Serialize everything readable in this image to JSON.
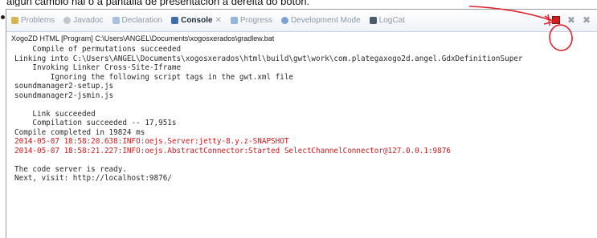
{
  "caption": "algún cambio hai o a pantalla de presentación á dereita do botón.",
  "tabs": [
    {
      "label": "Problems",
      "icon": "problems-icon",
      "active": false
    },
    {
      "label": "Javadoc",
      "icon": "javadoc-icon",
      "active": false
    },
    {
      "label": "Declaration",
      "icon": "declaration-icon",
      "active": false
    },
    {
      "label": "Console",
      "icon": "console-icon",
      "active": true
    },
    {
      "label": "Progress",
      "icon": "progress-icon",
      "active": false
    },
    {
      "label": "Development Mode",
      "icon": "development-mode-icon",
      "active": false
    },
    {
      "label": "LogCat",
      "icon": "logcat-icon",
      "active": false
    }
  ],
  "launch_path": "XogoZD HTML [Program] C:\\Users\\ANGEL\\Documents\\xogosxerados\\gradlew.bat",
  "console_lines": [
    {
      "text": "    Compile of permutations succeeded",
      "error": false
    },
    {
      "text": "Linking into C:\\Users\\ANGEL\\Documents\\xogosxerados\\html\\build\\gwt\\work\\com.plategaxogo2d.angel.GdxDefinitionSuper",
      "error": false
    },
    {
      "text": "    Invoking Linker Cross-Site-Iframe",
      "error": false
    },
    {
      "text": "        Ignoring the following script tags in the gwt.xml file",
      "error": false
    },
    {
      "text": "soundmanager2-setup.js",
      "error": false
    },
    {
      "text": "soundmanager2-jsmin.js",
      "error": false
    },
    {
      "text": "",
      "error": false
    },
    {
      "text": "    Link succeeded",
      "error": false
    },
    {
      "text": "    Compilation succeeded -- 17,951s",
      "error": false
    },
    {
      "text": "Compile completed in 19824 ms",
      "error": false
    },
    {
      "text": "2014-05-07 18:58:20.638:INFO:oejs.Server:jetty-8.y.z-SNAPSHOT",
      "error": true
    },
    {
      "text": "2014-05-07 18:58:21.227:INFO:oejs.AbstractConnector:Started SelectChannelConnector@127.0.0.1:9876",
      "error": true
    },
    {
      "text": "",
      "error": false
    },
    {
      "text": "The code server is ready.",
      "error": false
    },
    {
      "text": "Next, visit: http://localhost:9876/",
      "error": false
    }
  ],
  "colors": {
    "stop_button": "#d11d1d",
    "error_text": "#d01a1a",
    "annotation": "#e0202a"
  },
  "toolbar_icons": [
    "terminate-icon",
    "remove-launch-icon",
    "remove-all-terminated-icon"
  ]
}
